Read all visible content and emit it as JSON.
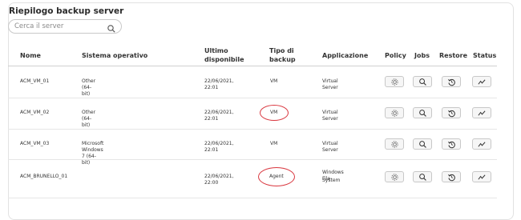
{
  "title": "Riepilogo backup server",
  "search": {
    "placeholder": "Cerca il server",
    "icon": "search-icon"
  },
  "columns": {
    "name": "Nome",
    "os": "Sistema operativo",
    "last_line1": "Ultimo",
    "last_line2": "disponibile",
    "type_line1": "Tipo di",
    "type_line2": "backup",
    "app": "Applicazione",
    "policy": "Policy",
    "jobs": "Jobs",
    "restore": "Restore",
    "status": "Status"
  },
  "rows": [
    {
      "name": "ACM_VM_01",
      "os": "Other (64-bit)",
      "last": "22/06/2021, 22:01",
      "type": "VM",
      "app_line1": "Virtual Server",
      "app_line2": "",
      "type_highlighted": false
    },
    {
      "name": "ACM_VM_02",
      "os": "Other (64-bit)",
      "last": "22/06/2021, 22:01",
      "type": "VM",
      "app_line1": "Virtual Server",
      "app_line2": "",
      "type_highlighted": true
    },
    {
      "name": "ACM_VM_03",
      "os": "Microsoft Windows 7 (64-bit)",
      "last": "22/06/2021, 22:01",
      "type": "VM",
      "app_line1": "Virtual Server",
      "app_line2": "",
      "type_highlighted": false
    },
    {
      "name": "ACM_BRUNELLO_01",
      "os": "",
      "last": "22/06/2021, 22:00",
      "type": "Agent",
      "app_line1": "Windows File",
      "app_line2": "System",
      "type_highlighted": true
    }
  ],
  "icons": {
    "policy": "gear-icon",
    "jobs": "magnifier-icon",
    "restore": "restore-icon",
    "status": "activity-chart-icon"
  },
  "colors": {
    "highlight": "#d9363e",
    "border": "#c8c8c8"
  }
}
